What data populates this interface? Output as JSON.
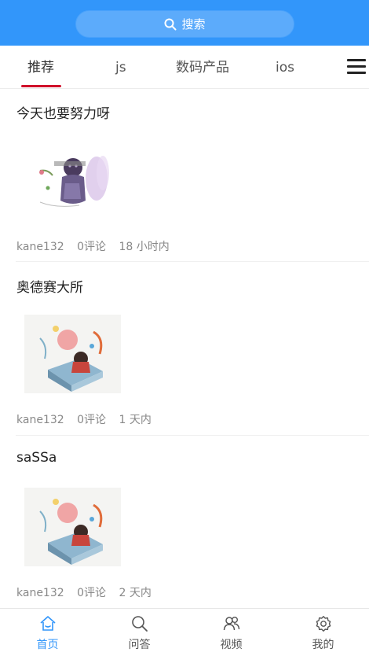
{
  "search": {
    "label": "搜索"
  },
  "tabs": [
    {
      "label": "推荐"
    },
    {
      "label": "js"
    },
    {
      "label": "数码产品"
    },
    {
      "label": "ios"
    }
  ],
  "posts": [
    {
      "title": "今天也要努力呀",
      "author": "kane132",
      "comments": "0评论",
      "time": "18 小时内"
    },
    {
      "title": "奥德赛大所",
      "author": "kane132",
      "comments": "0评论",
      "time": "1 天内"
    },
    {
      "title": "saSSa",
      "author": "kane132",
      "comments": "0评论",
      "time": "2 天内"
    }
  ],
  "bottom_nav": [
    {
      "label": "首页",
      "icon": "home-icon"
    },
    {
      "label": "问答",
      "icon": "search-icon"
    },
    {
      "label": "视频",
      "icon": "video-icon"
    },
    {
      "label": "我的",
      "icon": "gear-icon"
    }
  ],
  "colors": {
    "brand": "#3296fa",
    "tab_indicator": "#d0102a"
  }
}
